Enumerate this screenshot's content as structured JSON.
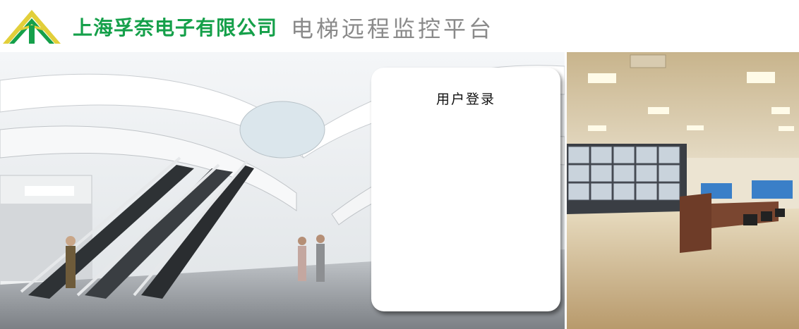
{
  "header": {
    "company_name": "上海孚奈电子有限公司",
    "platform_title": "电梯远程监控平台"
  },
  "login": {
    "title": "用户登录"
  },
  "colors": {
    "brand_green": "#15a04a",
    "logo_yellow": "#e2cf3a",
    "title_gray": "#8a8a8a"
  },
  "images": {
    "mall_photo": "mall-escalator-photo",
    "control_room_photo": "control-room-photo"
  }
}
